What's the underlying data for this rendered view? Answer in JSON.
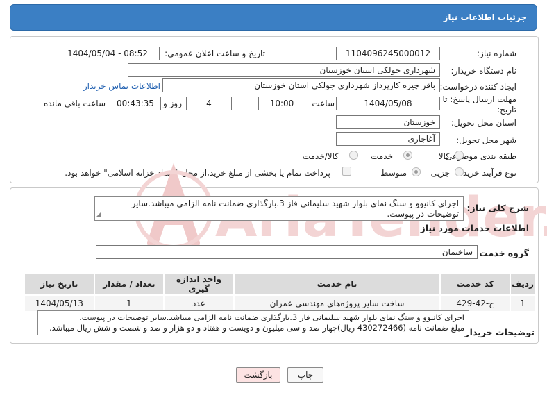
{
  "header": {
    "title": "جزئیات اطلاعات نیاز"
  },
  "form": {
    "need_number_label": "شماره نیاز:",
    "need_number": "1104096245000012",
    "announce_label": "تاریخ و ساعت اعلان عمومی:",
    "announce_value": "1404/05/04 - 08:52",
    "buyer_org_label": "نام دستگاه خریدار:",
    "buyer_org": "شهرداری جولکی استان خوزستان",
    "creator_label": "ایجاد کننده درخواست:",
    "creator": "باقر چیره کارپرداز شهرداری جولکی استان خوزستان",
    "contact_link": "اطلاعات تماس خریدار",
    "deadline_label": "مهلت ارسال پاسخ: تا تاریخ:",
    "deadline_date": "1404/05/08",
    "time_label": "ساعت",
    "deadline_time": "10:00",
    "days_value": "4",
    "days_label": "روز و",
    "remaining_value": "00:43:35",
    "remaining_label": "ساعت باقی مانده",
    "province_label": "استان محل تحویل:",
    "province": "خوزستان",
    "city_label": "شهر محل تحویل:",
    "city": "آغاجاری",
    "category_label": "طبقه بندی موضوعی:",
    "category_options": [
      "کالا",
      "خدمت",
      "کالا/خدمت"
    ],
    "process_label": "نوع فرآیند خرید :",
    "process_options": [
      "جزیی",
      "متوسط"
    ],
    "payment_note": "پرداخت تمام یا بخشی از مبلغ خرید،از محل \"اسناد خزانه اسلامی\" خواهد بود."
  },
  "summary": {
    "label": "شرح کلی نیاز:",
    "text": "اجرای کانیوو و سنگ نمای بلوار شهید سلیمانی فاز 3.بارگذاری ضمانت نامه الزامی میباشد.سایر توضیحات در پیوست."
  },
  "services": {
    "section_title": "اطلاعات خدمات مورد نیاز",
    "group_label": "گروه خدمت:",
    "group_value": "ساختمان",
    "columns": [
      "ردیف",
      "کد خدمت",
      "نام خدمت",
      "واحد اندازه گیری",
      "تعداد / مقدار",
      "تاریخ نیاز"
    ],
    "rows": [
      [
        "1",
        "ج-42-429",
        "ساخت سایر پروژه‌های مهندسی عمران",
        "عدد",
        "1",
        "1404/05/13"
      ]
    ]
  },
  "buyer_notes": {
    "label": "توضیحات خریدار:",
    "line1": "اجرای کانیوو و سنگ نمای بلوار شهید سلیمانی فاز 3.بارگذاری ضمانت نامه الزامی میباشد.سایر توضیحات در پیوست.",
    "line2": "مبلغ ضمانت نامه (430272466 ریال)چهار صد و سی میلیون و دویست و هفتاد و دو هزار و صد و شصت و شش ریال میباشد."
  },
  "buttons": {
    "print": "چاپ",
    "back": "بازگشت"
  },
  "watermark_text": "AriaTender.neT",
  "colors": {
    "header": "#3b7fc4",
    "link": "#1f5fb0",
    "back_button": "#fde3e3",
    "watermark": "#f0c9c9"
  }
}
